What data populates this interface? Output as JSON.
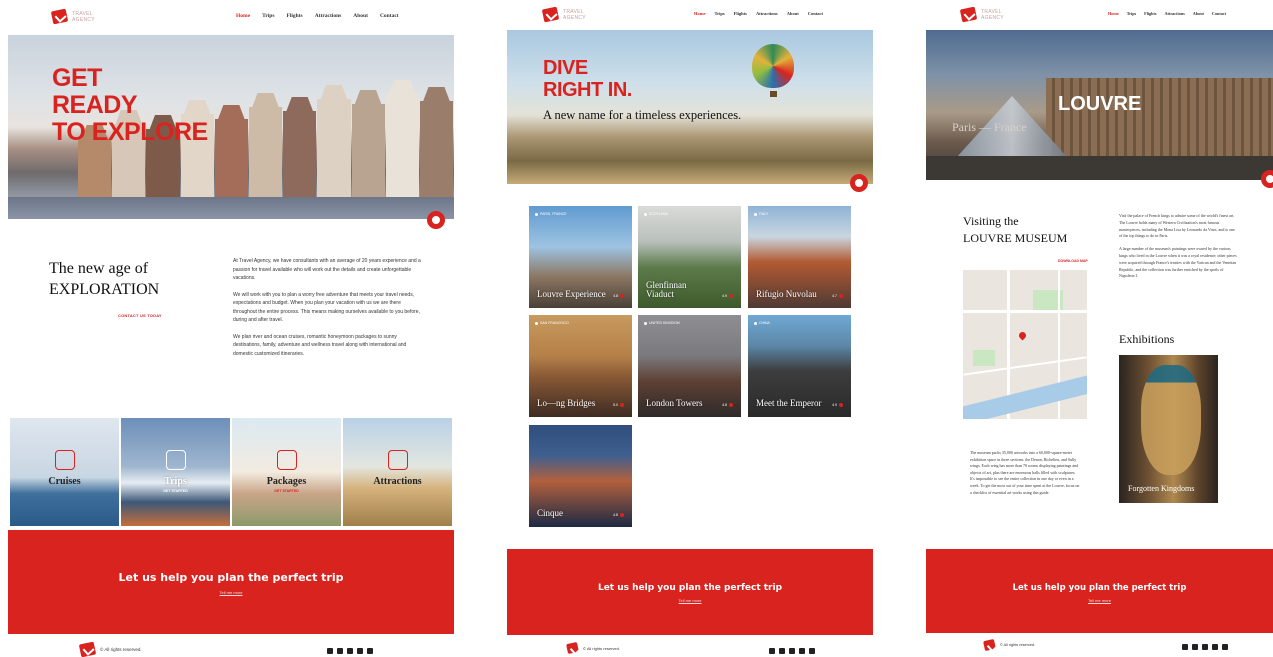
{
  "colors": {
    "brand_red": "#d8231f",
    "text_dark": "#111111",
    "background": "#ffffff"
  },
  "icons": {
    "logo": "travel-agency-logo-icon",
    "social": [
      "linkedin-icon",
      "facebook-icon",
      "twitter-icon",
      "instagram-icon",
      "youtube-icon"
    ]
  },
  "brand": {
    "line1": "Travel",
    "line2": "Agency"
  },
  "nav": {
    "items": [
      "Home",
      "Trips",
      "Flights",
      "Attractions",
      "About",
      "Contact"
    ],
    "active": "Home"
  },
  "home": {
    "hero_line1": "GET",
    "hero_line2": "READY",
    "hero_line3": "TO EXPLORE",
    "intro_heading_line1": "The new age of",
    "intro_heading_line2": "EXPLORATION",
    "contact_link": "CONTACT US TODAY",
    "paragraphs": [
      "At Travel Agency, we have consultants with an average of 20 years experience and a passion for travel available who will work out the details and create unforgettable vacations.",
      "We will work with you to plan a worry free adventure that meets your travel needs, expectations and budget. When you plan your vacation with us we are there throughout the entire process.  This means making ourselves available to you before, during and after travel.",
      "We plan river and ocean cruises, romantic honeymoon packages to sunny destinations, family, adventure and wellness travel along with international and domestic customized itineraries."
    ],
    "tiles": [
      {
        "label": "Cruises",
        "sub": "",
        "icon": "ship-icon"
      },
      {
        "label": "Trips",
        "sub": "GET STARTED",
        "icon": "airplane-icon"
      },
      {
        "label": "Packages",
        "sub": "GET STARTED",
        "icon": "luggage-icon"
      },
      {
        "label": "Attractions",
        "sub": "",
        "icon": "landmark-icon"
      }
    ]
  },
  "trips": {
    "hero_line1": "DIVE",
    "hero_line2": "RIGHT IN.",
    "hero_sub": "A new name for a timeless experiences.",
    "cards": [
      {
        "title": "Louvre Experience",
        "tag": "PARIS, FRANCE",
        "rating": "4.8"
      },
      {
        "title": "Glenfinnan Viaduct",
        "tag": "SCOTLAND",
        "rating": "4.9"
      },
      {
        "title": "Rifugio Nuvolau",
        "tag": "ITALY",
        "rating": "4.7"
      },
      {
        "title": "Lo—ng Bridges",
        "tag": "SAN FRANCISCO",
        "rating": "5.0"
      },
      {
        "title": "London Towers",
        "tag": "UNITED KINGDOM",
        "rating": "4.8"
      },
      {
        "title": "Meet the Emperor",
        "tag": "CHINA",
        "rating": "4.9"
      },
      {
        "title": "Cinque",
        "tag": "",
        "rating": "4.8"
      }
    ]
  },
  "attraction": {
    "hero_title": "LOUVRE",
    "hero_sub": "Paris — France",
    "visit_line1": "Visiting the",
    "visit_line2": "LOUVRE MUSEUM",
    "visit_link": "DOWNLOAD MAP",
    "visit_paragraphs": [
      "Visit the palace of French kings to admire some of the world's finest art. The Louvre holds many of Western Civilization's most famous masterpieces, including the Mona Lisa by Leonardo da Vinci, and is one of the top things to do in Paris.",
      "A large number of the museum's paintings were owned by the various kings who lived in the Louvre when it was a royal residence; other pieces were acquired through France's treaties with the Vatican and the Venetian Republic, and the collection was further enriched by the spoils of Napoleon I."
    ],
    "museum_paragraph": "The museum packs 35,000 artworks into a 60,000-square-meter exhibition space in three sections: the Denon, Richelieu, and Sully wings. Each wing has more than 70 rooms displaying paintings and objects of art, plus there are enormous halls filled with sculptures. It's impossible to see the entire collection in one day or even in a week. To get the most out of your time spent at the Louvre, focus on a checklist of essential art works using this guide.",
    "exhibitions_heading": "Exhibitions",
    "exhibition_title": "Forgotten Kingdoms"
  },
  "cta": {
    "title": "Let us help you plan the perfect trip",
    "link": "Tell me more"
  },
  "footer": {
    "copyright": "© All rights reserved."
  }
}
